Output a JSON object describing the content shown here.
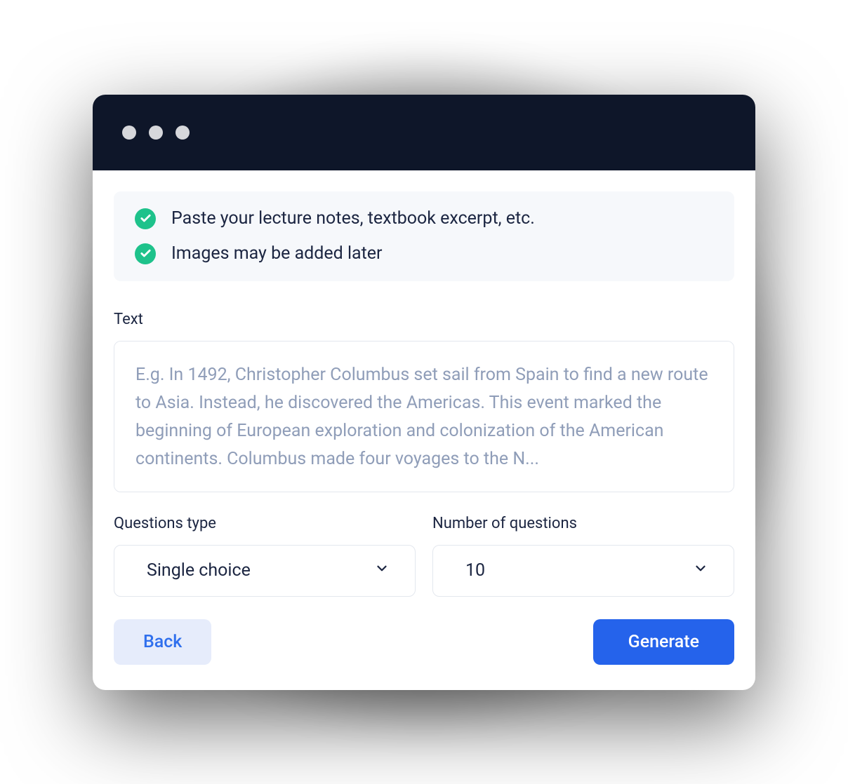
{
  "info": {
    "items": [
      "Paste your lecture notes, textbook excerpt, etc.",
      "Images may be added later"
    ]
  },
  "text_field": {
    "label": "Text",
    "placeholder": "E.g. In 1492, Christopher Columbus set sail from Spain to find a new route to Asia. Instead, he discovered the Americas. This event marked the beginning of European exploration and colonization of the American continents. Columbus made four voyages to the N..."
  },
  "questions_type": {
    "label": "Questions type",
    "value": "Single choice"
  },
  "number_of_questions": {
    "label": "Number of questions",
    "value": "10"
  },
  "buttons": {
    "back": "Back",
    "generate": "Generate"
  }
}
